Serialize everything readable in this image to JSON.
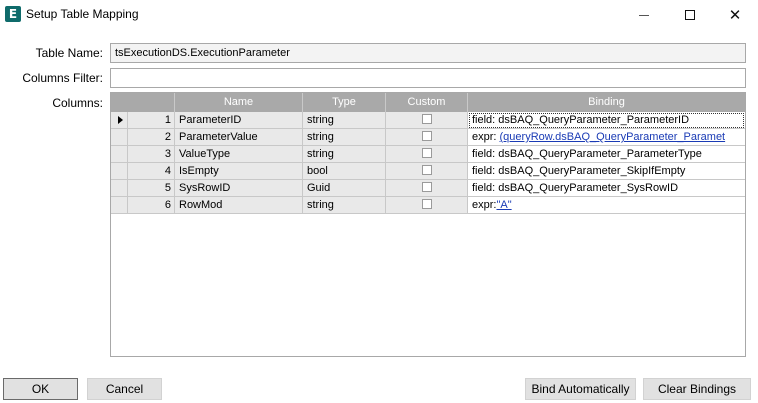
{
  "window": {
    "title": "Setup Table Mapping",
    "app_icon": "E",
    "controls": {
      "minimize": "minimize-icon",
      "maximize": "maximize-icon",
      "close": "close-icon"
    }
  },
  "form": {
    "table_name_label": "Table Name:",
    "table_name_value": "tsExecutionDS.ExecutionParameter",
    "columns_filter_label": "Columns Filter:",
    "columns_filter_value": "",
    "columns_label": "Columns:"
  },
  "grid": {
    "headers": {
      "name": "Name",
      "type": "Type",
      "custom": "Custom",
      "binding": "Binding"
    },
    "rows": [
      {
        "num": "1",
        "name": "ParameterID",
        "type": "string",
        "custom": false,
        "binding_prefix": "field: ",
        "binding_value": "dsBAQ_QueryParameter_ParameterID",
        "binding_link": ""
      },
      {
        "num": "2",
        "name": "ParameterValue",
        "type": "string",
        "custom": false,
        "binding_prefix": "expr: ",
        "binding_value": "",
        "binding_link": "(queryRow.dsBAQ_QueryParameter_Paramet"
      },
      {
        "num": "3",
        "name": "ValueType",
        "type": "string",
        "custom": false,
        "binding_prefix": "field: ",
        "binding_value": "dsBAQ_QueryParameter_ParameterType",
        "binding_link": ""
      },
      {
        "num": "4",
        "name": "IsEmpty",
        "type": "bool",
        "custom": false,
        "binding_prefix": "field: ",
        "binding_value": "dsBAQ_QueryParameter_SkipIfEmpty",
        "binding_link": ""
      },
      {
        "num": "5",
        "name": "SysRowID",
        "type": "Guid",
        "custom": false,
        "binding_prefix": "field: ",
        "binding_value": "dsBAQ_QueryParameter_SysRowID",
        "binding_link": ""
      },
      {
        "num": "6",
        "name": "RowMod",
        "type": "string",
        "custom": false,
        "binding_prefix": "expr:",
        "binding_value": "",
        "binding_link": "\"A\""
      }
    ]
  },
  "buttons": {
    "ok": "OK",
    "cancel": "Cancel",
    "bind_automatically": "Bind Automatically",
    "clear_bindings": "Clear Bindings"
  }
}
